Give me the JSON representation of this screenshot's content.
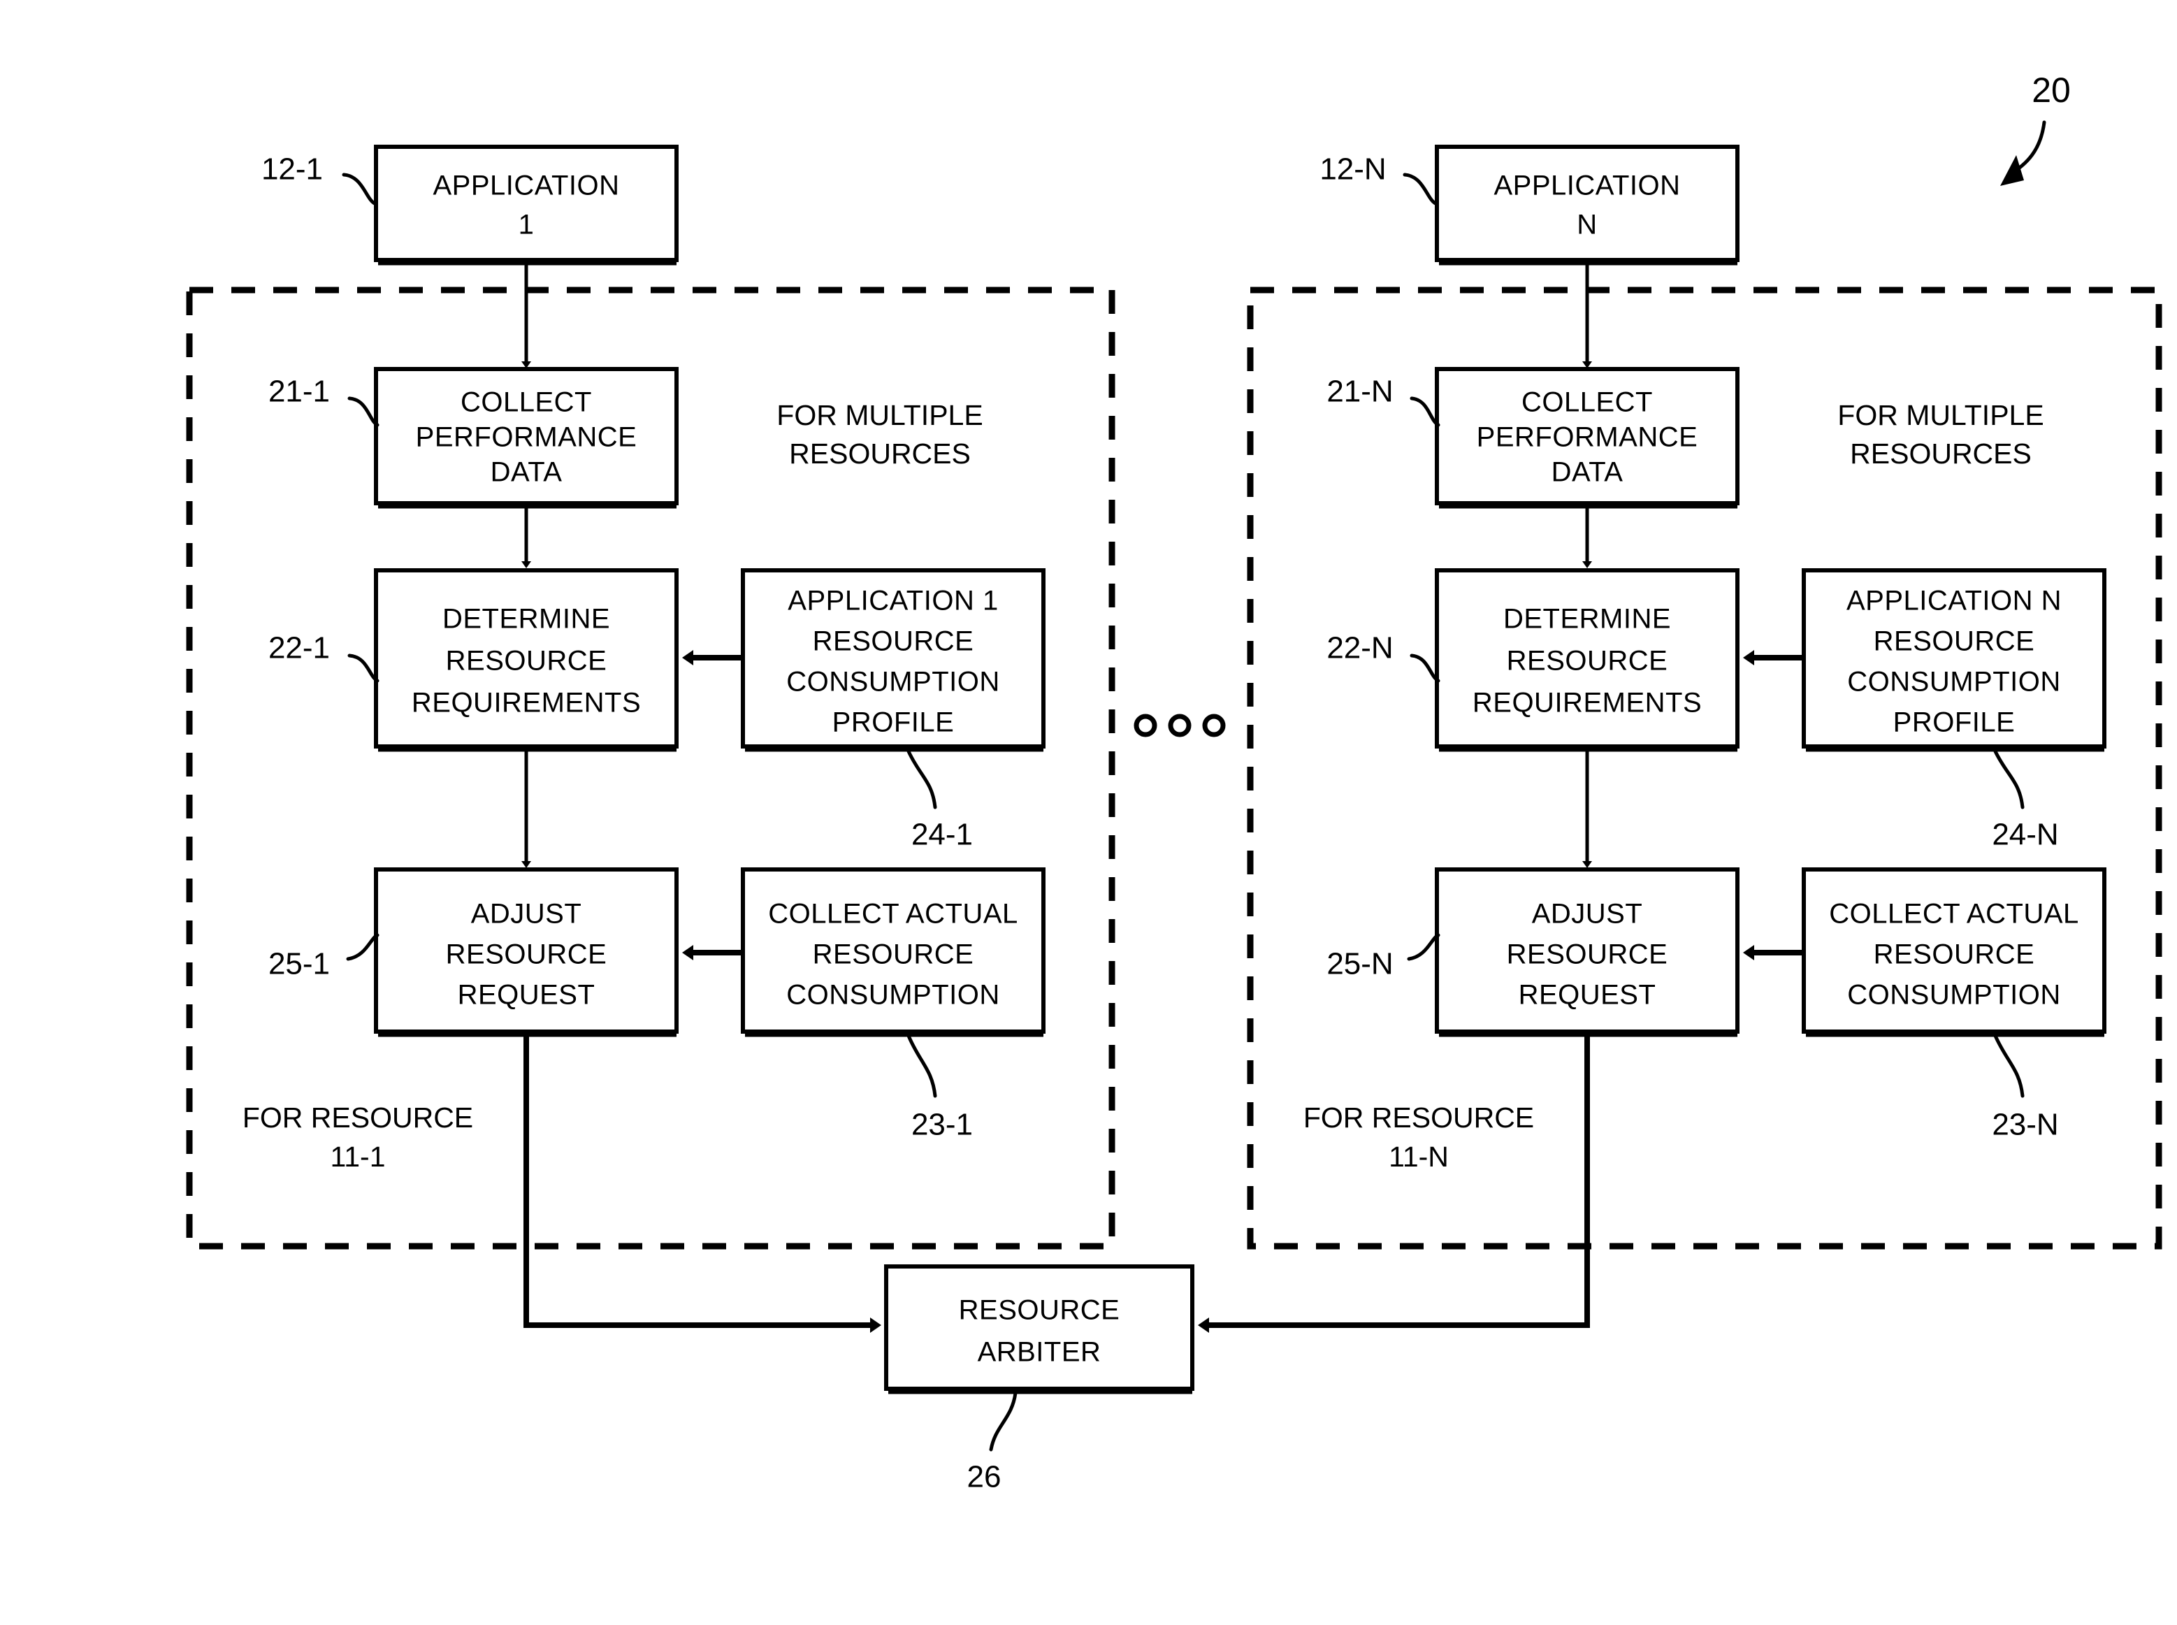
{
  "figure": {
    "number": "20",
    "type": "patent-flow-diagram",
    "title": "Resource arbitration flow for multiple applications"
  },
  "panels": [
    {
      "id": "panel-1",
      "suffix": "1",
      "application_box": {
        "ref": "12-1",
        "line1": "APPLICATION",
        "line2": "1"
      },
      "collect_performance": {
        "ref": "21-1",
        "line1": "COLLECT",
        "line2": "PERFORMANCE",
        "line3": "DATA"
      },
      "determine_requirements": {
        "ref": "22-1",
        "line1": "DETERMINE",
        "line2": "RESOURCE",
        "line3": "REQUIREMENTS"
      },
      "consumption_profile": {
        "ref": "24-1",
        "line1": "APPLICATION 1",
        "line2": "RESOURCE",
        "line3": "CONSUMPTION",
        "line4": "PROFILE"
      },
      "adjust_request": {
        "ref": "25-1",
        "line1": "ADJUST",
        "line2": "RESOURCE",
        "line3": "REQUEST"
      },
      "collect_actual": {
        "ref": "23-1",
        "line1": "COLLECT ACTUAL",
        "line2": "RESOURCE",
        "line3": "CONSUMPTION"
      },
      "note_multiple": {
        "line1": "FOR MULTIPLE",
        "line2": "RESOURCES"
      },
      "note_resource": {
        "line1": "FOR RESOURCE",
        "line2": "11-1"
      }
    },
    {
      "id": "panel-n",
      "suffix": "N",
      "application_box": {
        "ref": "12-N",
        "line1": "APPLICATION",
        "line2": "N"
      },
      "collect_performance": {
        "ref": "21-N",
        "line1": "COLLECT",
        "line2": "PERFORMANCE",
        "line3": "DATA"
      },
      "determine_requirements": {
        "ref": "22-N",
        "line1": "DETERMINE",
        "line2": "RESOURCE",
        "line3": "REQUIREMENTS"
      },
      "consumption_profile": {
        "ref": "24-N",
        "line1": "APPLICATION N",
        "line2": "RESOURCE",
        "line3": "CONSUMPTION",
        "line4": "PROFILE"
      },
      "adjust_request": {
        "ref": "25-N",
        "line1": "ADJUST",
        "line2": "RESOURCE",
        "line3": "REQUEST"
      },
      "collect_actual": {
        "ref": "23-N",
        "line1": "COLLECT ACTUAL",
        "line2": "RESOURCE",
        "line3": "CONSUMPTION"
      },
      "note_multiple": {
        "line1": "FOR MULTIPLE",
        "line2": "RESOURCES"
      },
      "note_resource": {
        "line1": "FOR RESOURCE",
        "line2": "11-N"
      }
    }
  ],
  "arbiter": {
    "ref": "26",
    "line1": "RESOURCE",
    "line2": "ARBITER"
  },
  "ellipsis": {
    "glyph": "o o o",
    "count": 3
  },
  "colors": {
    "ink": "#000000",
    "paper": "#ffffff"
  }
}
